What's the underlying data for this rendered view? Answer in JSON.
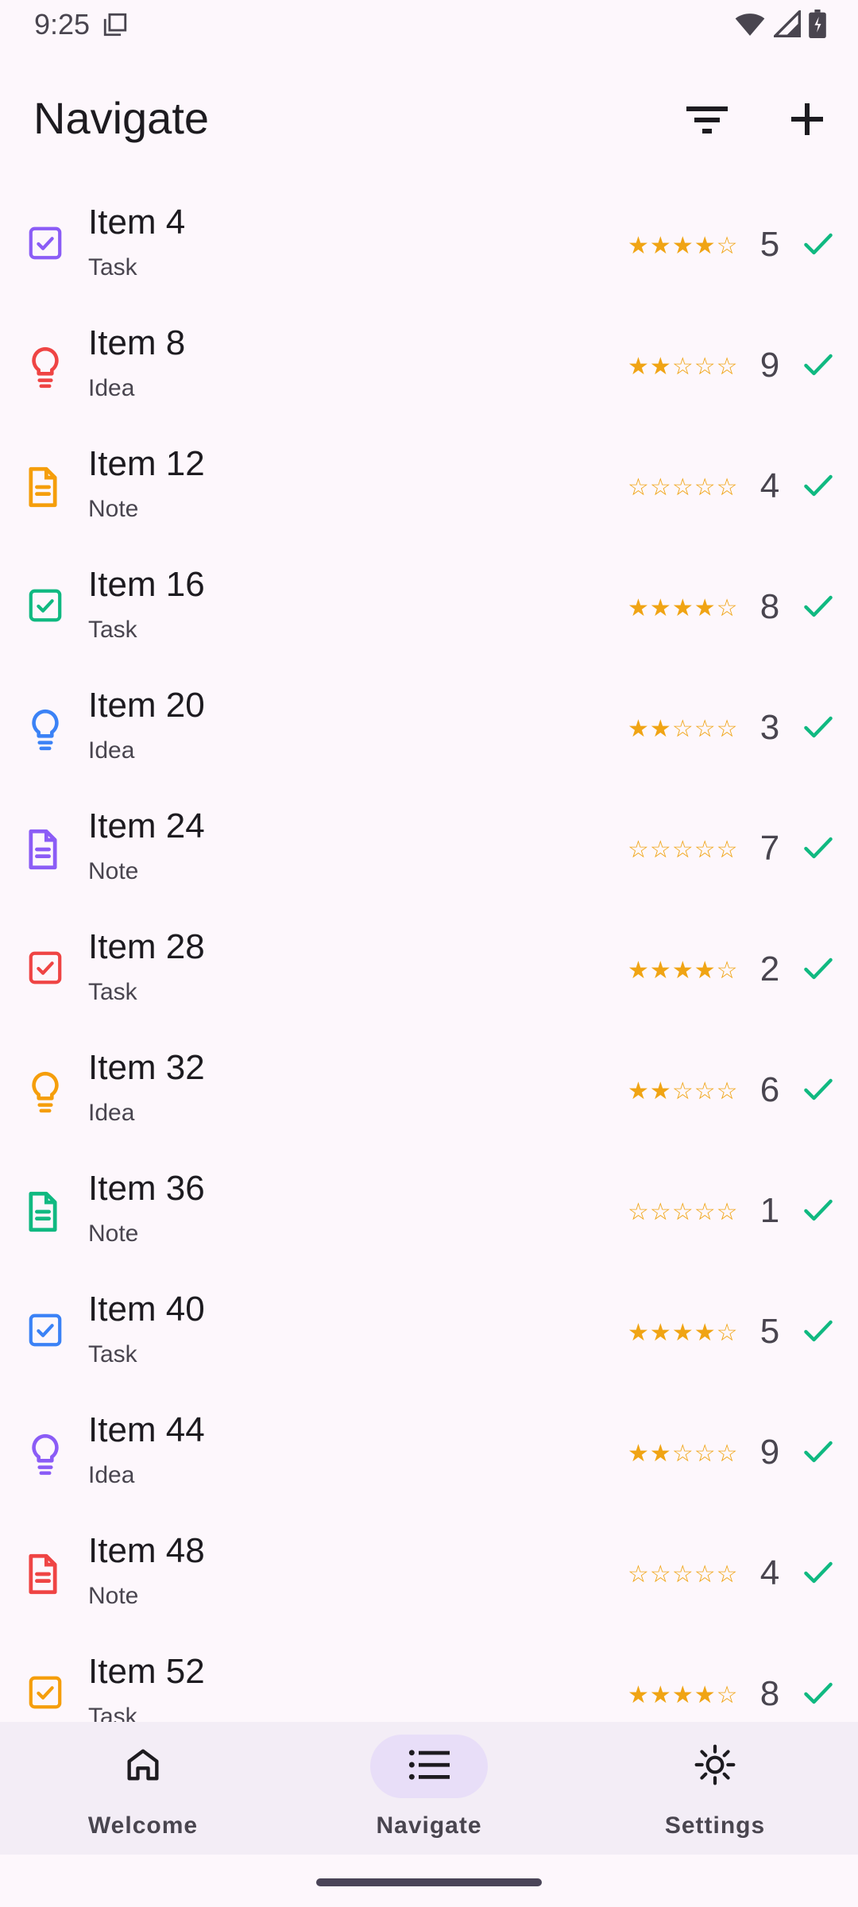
{
  "status_bar": {
    "time": "9:25",
    "icons": [
      "screenshot-icon",
      "wifi-icon",
      "signal-icon",
      "battery-icon"
    ]
  },
  "app_bar": {
    "title": "Navigate",
    "actions": [
      "filter-icon",
      "add-icon"
    ]
  },
  "colors": {
    "purple": "#8b5cf6",
    "red": "#ef4444",
    "amber": "#f59e0b",
    "green": "#10b981",
    "blue": "#3b82f6",
    "star": "#f0a414",
    "check": "#10b981"
  },
  "items": [
    {
      "title": "Item 4",
      "type": "Task",
      "icon": "task-icon",
      "color": "#8b5cf6",
      "rating": 4,
      "count": "5"
    },
    {
      "title": "Item 8",
      "type": "Idea",
      "icon": "idea-icon",
      "color": "#ef4444",
      "rating": 2,
      "count": "9"
    },
    {
      "title": "Item 12",
      "type": "Note",
      "icon": "note-icon",
      "color": "#f59e0b",
      "rating": 0,
      "count": "4"
    },
    {
      "title": "Item 16",
      "type": "Task",
      "icon": "task-icon",
      "color": "#10b981",
      "rating": 4,
      "count": "8"
    },
    {
      "title": "Item 20",
      "type": "Idea",
      "icon": "idea-icon",
      "color": "#3b82f6",
      "rating": 2,
      "count": "3"
    },
    {
      "title": "Item 24",
      "type": "Note",
      "icon": "note-icon",
      "color": "#8b5cf6",
      "rating": 0,
      "count": "7"
    },
    {
      "title": "Item 28",
      "type": "Task",
      "icon": "task-icon",
      "color": "#ef4444",
      "rating": 4,
      "count": "2"
    },
    {
      "title": "Item 32",
      "type": "Idea",
      "icon": "idea-icon",
      "color": "#f59e0b",
      "rating": 2,
      "count": "6"
    },
    {
      "title": "Item 36",
      "type": "Note",
      "icon": "note-icon",
      "color": "#10b981",
      "rating": 0,
      "count": "1"
    },
    {
      "title": "Item 40",
      "type": "Task",
      "icon": "task-icon",
      "color": "#3b82f6",
      "rating": 4,
      "count": "5"
    },
    {
      "title": "Item 44",
      "type": "Idea",
      "icon": "idea-icon",
      "color": "#8b5cf6",
      "rating": 2,
      "count": "9"
    },
    {
      "title": "Item 48",
      "type": "Note",
      "icon": "note-icon",
      "color": "#ef4444",
      "rating": 0,
      "count": "4"
    },
    {
      "title": "Item 52",
      "type": "Task",
      "icon": "task-icon",
      "color": "#f59e0b",
      "rating": 4,
      "count": "8"
    }
  ],
  "bottom_nav": {
    "items": [
      {
        "label": "Welcome",
        "icon": "home-icon",
        "selected": false
      },
      {
        "label": "Navigate",
        "icon": "list-icon",
        "selected": true
      },
      {
        "label": "Settings",
        "icon": "settings-icon",
        "selected": false
      }
    ],
    "selected_pill_color": "#e8def8"
  }
}
